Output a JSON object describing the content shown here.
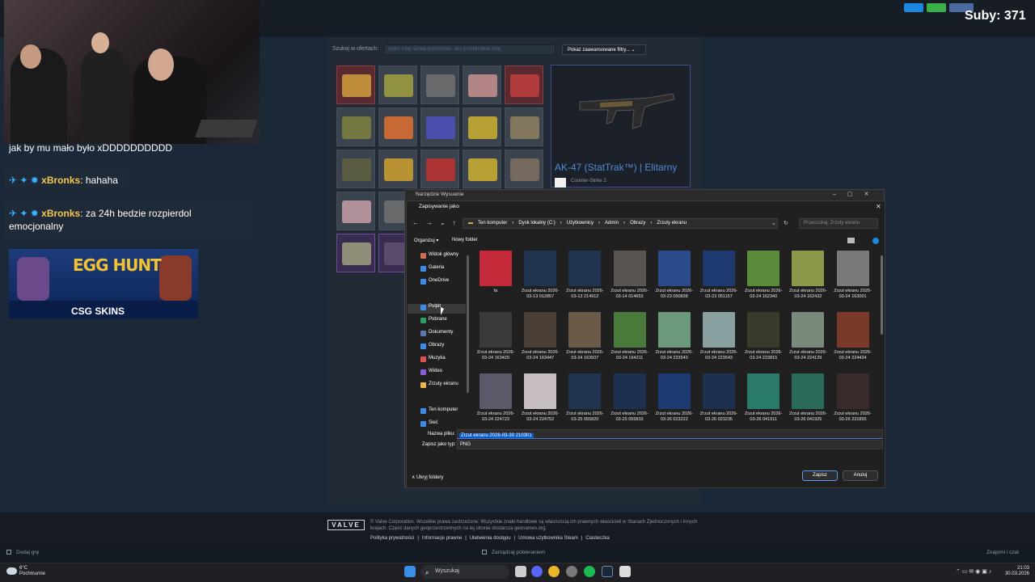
{
  "market": {
    "search_label": "Szukaj w ofertach:",
    "search_placeholder": "wpisz tutaj nazwę przedmiotu, aby przefiltrować listę",
    "advanced_button": "Pokaż zaawansowane filtry... ⌄",
    "selected_item_title": "AK-47 (StatTrak™) | Elitarny",
    "selected_item_game": "Counter-Strike 2"
  },
  "overlay": {
    "chat": [
      {
        "user": "",
        "text": "jak by mu mało było xDDDDDDDDDD"
      },
      {
        "user": "xBronks",
        "text": ": hahaha"
      },
      {
        "user": "xBronks",
        "text": ": za 24h bedzie rozpierdol emocjonalny"
      }
    ],
    "banner_title": "EGG HUNT",
    "banner_brand": "CSG SKINS",
    "subs": "Suby: 371"
  },
  "dialog": {
    "outer_title": "Narzędzie Wysuanie",
    "title": "Zapisywanie jako",
    "breadcrumb": [
      "Ten komputer",
      "Dysk lokalny (C:)",
      "Użytkownicy",
      "Admin",
      "Obrazy",
      "Zrzuty ekranu"
    ],
    "search_placeholder": "Przeszukaj: Zrzuty ekranu",
    "organize": "Organizuj ▾",
    "new_folder": "Nowy folder",
    "nav": [
      "Widok główny",
      "Galeria",
      "OneDrive",
      "Pulpit",
      "Pobrane",
      "Dokumenty",
      "Obrazy",
      "Muzyka",
      "Wideo",
      "Zrzuty ekranu",
      "Ten komputer",
      "Sieć"
    ],
    "files": [
      {
        "label": "fa",
        "color": "#c42a3a"
      },
      {
        "label": "Zrzut ekranu 2026-03-13 012857",
        "color": "#20344f"
      },
      {
        "label": "Zrzut ekranu 2026-03-13 214912",
        "color": "#20344f"
      },
      {
        "label": "Zrzut ekranu 2026-03-14 014653",
        "color": "#5a5550"
      },
      {
        "label": "Zrzut ekranu 2026-03-23 050838",
        "color": "#2a4a8a"
      },
      {
        "label": "Zrzut ekranu 2026-03-23 051157",
        "color": "#1e3a70"
      },
      {
        "label": "Zrzut ekranu 2026-03-24 162340",
        "color": "#5a8a3a"
      },
      {
        "label": "Zrzut ekranu 2026-03-24 162432",
        "color": "#8a9a4a"
      },
      {
        "label": "Zrzut ekranu 2026-03-24 163001",
        "color": "#7a7a7a"
      },
      {
        "label": "Zrzut ekranu 2026-03-24 163429",
        "color": "#3a3a3a"
      },
      {
        "label": "Zrzut ekranu 2026-03-24 163447",
        "color": "#4a4038"
      },
      {
        "label": "Zrzut ekranu 2026-03-24 163507",
        "color": "#6a5a4a"
      },
      {
        "label": "Zrzut ekranu 2026-03-24 164211",
        "color": "#4a7a3a"
      },
      {
        "label": "Zrzut ekranu 2026-03-24 223540",
        "color": "#6a9a7a"
      },
      {
        "label": "Zrzut ekranu 2026-03-24 223543",
        "color": "#8aa0a0"
      },
      {
        "label": "Zrzut ekranu 2026-03-24 223815",
        "color": "#3a3a2a"
      },
      {
        "label": "Zrzut ekranu 2026-03-24 224129",
        "color": "#7a8a7a"
      },
      {
        "label": "Zrzut ekranu 2026-03-24 224424",
        "color": "#7a3a2a"
      },
      {
        "label": "Zrzut ekranu 2026-03-24 224723",
        "color": "#5a5a6a"
      },
      {
        "label": "Zrzut ekranu 2026-03-24 224752",
        "color": "#c8c0c0"
      },
      {
        "label": "Zrzut ekranu 2026-03-25 055820",
        "color": "#20344f"
      },
      {
        "label": "Zrzut ekranu 2026-03-25 055833",
        "color": "#1e3050"
      },
      {
        "label": "Zrzut ekranu 2026-03-26 023222",
        "color": "#1e3a70"
      },
      {
        "label": "Zrzut ekranu 2026-03-26 023235",
        "color": "#1e3050"
      },
      {
        "label": "Zrzut ekranu 2026-03-26 041911",
        "color": "#2a7a6a"
      },
      {
        "label": "Zrzut ekranu 2026-03-26 041925",
        "color": "#2a6a5a"
      },
      {
        "label": "Zrzut ekranu 2026-03-26 231855",
        "color": "#3a2a2a"
      }
    ],
    "filename_label": "Nazwa pliku:",
    "filename_value": "Zrzut ekranu 2026-03-30 210301",
    "type_label": "Zapisz jako typ:",
    "type_value": "PNG",
    "hide_folders": "∧ Ukryj foldery",
    "save_button": "Zapisz",
    "cancel_button": "Anuluj"
  },
  "footer": {
    "valve": "VALVE",
    "legal": "© Valve Corporation. Wszelkie prawa zastrzeżone. Wszystkie znaki handlowe są własnością ich prawnych właścicieli w Stanach Zjednoczonych i innych krajach. Część danych geoprzestrzennych na tej stronie dostarcza geonames.org.",
    "links": [
      "Polityka prywatności",
      "|",
      "Informacje prawne",
      "|",
      "Ułatwienia dostępu",
      "|",
      "Umowa użytkownika Steam",
      "|",
      "Ciasteczka"
    ]
  },
  "steam_status": {
    "add_game": "Dodaj grę",
    "downloads": "Zarządzaj pobieraniem",
    "friends": "Znajomi i czat"
  },
  "taskbar": {
    "weather_temp": "6°C",
    "weather_desc": "Pochmurnie",
    "search": "Wyszukaj",
    "time": "21:03",
    "date": "30.03.2026"
  }
}
